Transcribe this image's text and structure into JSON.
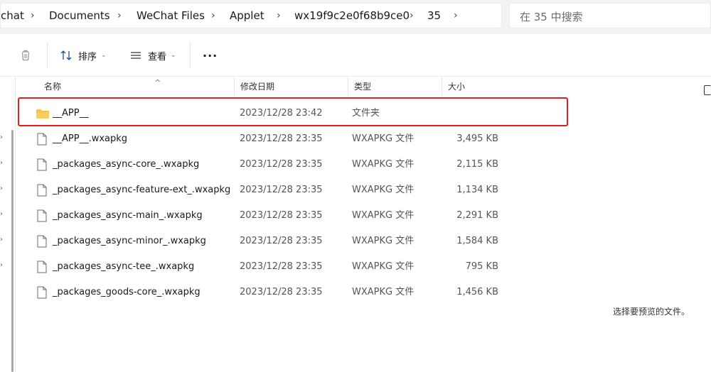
{
  "breadcrumb": [
    "chat",
    "Documents",
    "WeChat Files",
    "Applet",
    "wx19f9c2e0f68b9ce0",
    "35"
  ],
  "search": {
    "placeholder": "在 35 中搜索"
  },
  "toolbar": {
    "sort_label": "排序",
    "view_label": "查看",
    "more_label": "···"
  },
  "columns": {
    "name": "名称",
    "date": "修改日期",
    "type": "类型",
    "size": "大小"
  },
  "files": [
    {
      "name": "__APP__",
      "date": "2023/12/28 23:42",
      "type": "文件夹",
      "size": "",
      "icon": "folder-icon"
    },
    {
      "name": "__APP__.wxapkg",
      "date": "2023/12/28 23:35",
      "type": "WXAPKG 文件",
      "size": "3,495 KB",
      "icon": "file-icon"
    },
    {
      "name": "_packages_async-core_.wxapkg",
      "date": "2023/12/28 23:35",
      "type": "WXAPKG 文件",
      "size": "2,115 KB",
      "icon": "file-icon"
    },
    {
      "name": "_packages_async-feature-ext_.wxapkg",
      "date": "2023/12/28 23:35",
      "type": "WXAPKG 文件",
      "size": "1,134 KB",
      "icon": "file-icon"
    },
    {
      "name": "_packages_async-main_.wxapkg",
      "date": "2023/12/28 23:35",
      "type": "WXAPKG 文件",
      "size": "2,291 KB",
      "icon": "file-icon"
    },
    {
      "name": "_packages_async-minor_.wxapkg",
      "date": "2023/12/28 23:35",
      "type": "WXAPKG 文件",
      "size": "1,584 KB",
      "icon": "file-icon"
    },
    {
      "name": "_packages_async-tee_.wxapkg",
      "date": "2023/12/28 23:35",
      "type": "WXAPKG 文件",
      "size": "795 KB",
      "icon": "file-icon"
    },
    {
      "name": "_packages_goods-core_.wxapkg",
      "date": "2023/12/28 23:35",
      "type": "WXAPKG 文件",
      "size": "1,456 KB",
      "icon": "file-icon"
    }
  ],
  "preview": {
    "message": "选择要预览的文件。"
  },
  "colors": {
    "highlight": "#e02020",
    "folder": "#f2c14e"
  }
}
